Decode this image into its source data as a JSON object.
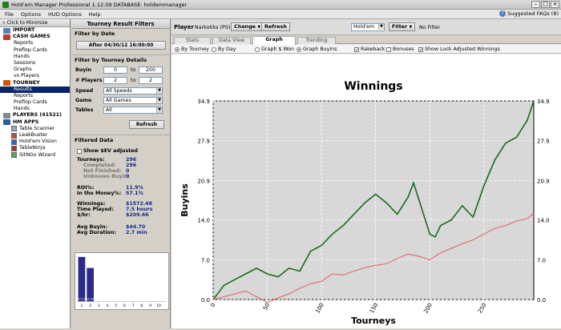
{
  "window": {
    "title": "Hold'em Manager Professional 1.12.09     DATABASE: holdemmanager"
  },
  "menu": {
    "items": [
      "File",
      "Options",
      "HUD Options",
      "Help"
    ],
    "faq": "Suggested FAQs (8)"
  },
  "nav": {
    "minimize_label": "Click to Minimize",
    "import": "IMPORT",
    "cash_games": "CASH GAMES",
    "cash_items": [
      "Reports",
      "Preflop Cards",
      "Hands",
      "Sessions",
      "Graphs",
      "vs Players"
    ],
    "tourney": "TOURNEY",
    "tourney_items": [
      "Results",
      "Reports",
      "Preflop Cards",
      "Hands"
    ],
    "players": "PLAYERS (41521)",
    "hm_apps": "HM APPS",
    "apps": [
      "Table Scanner",
      "LeakBuster",
      "Hold'em Vision",
      "TableNinja",
      "SitNGo Wizard"
    ]
  },
  "filters": {
    "title": "Tourney Result Filters",
    "by_date": "Filter by Date",
    "after_date": "After 04/30/12 16:00:00",
    "by_details": "Filter by Tourney Details",
    "buyin_label": "Buyin",
    "buyin_from": "0",
    "buyin_to": "200",
    "players_label": "# Players",
    "players_from": "2",
    "players_to": "2",
    "to": "to",
    "speed_label": "Speed",
    "speed_value": "All Speeds",
    "game_label": "Game",
    "game_value": "All Games",
    "tables_label": "Tables",
    "tables_value": "All",
    "refresh": "Refresh",
    "filtered_data": "Filtered Data",
    "sev_label": "Show $EV adjusted"
  },
  "stats": {
    "tourneys_label": "Tourneys:",
    "tourneys": "296",
    "completed_label": "Completed:",
    "completed": "296",
    "not_finished_label": "Not Finished:",
    "not_finished": "0",
    "unknown_buyin_label": "Unknown Buyin:",
    "unknown_buyin": "0",
    "roi_label": "ROI%:",
    "roi": "11.9%",
    "itm_label": "In the Money%:",
    "itm": "57.1%",
    "winnings_label": "Winnings:",
    "winnings": "$1572.48",
    "time_label": "Time Played:",
    "time": "7.5 hours",
    "hr_label": "$/hr:",
    "hr": "$209.66",
    "avg_buyin_label": "Avg Buyin:",
    "avg_buyin": "$44.70",
    "avg_duration_label": "Avg Duration:",
    "avg_duration": "2.7 min"
  },
  "minichart": {
    "bar_labels": [
      "57.1%",
      "42.9%"
    ],
    "x_ticks": [
      "1",
      "2",
      "3",
      "4",
      "5",
      "6",
      "7",
      "8",
      "9",
      "10"
    ],
    "values": [
      57.1,
      42.9
    ]
  },
  "toolbar": {
    "player_label": "Player",
    "player_name": "Narkotiks (PS)",
    "change": "Change",
    "refresh": "Refresh",
    "game": "Hold'em",
    "filter": "Filter",
    "no_filter": "No Filter"
  },
  "tabs": [
    "Stats",
    "Data View",
    "Graph",
    "Trending"
  ],
  "active_tab": "Graph",
  "options": {
    "by_tourney": "By Tourney",
    "by_day": "By Day",
    "graph_won": "Graph $ Won",
    "graph_buyins": "Graph Buyins",
    "rakeback": "Rakeback",
    "bonuses": "Bonuses",
    "luck": "Show Luck Adjusted Winnings"
  },
  "chart_data": {
    "type": "line",
    "title": "Winnings",
    "xlabel": "Tourneys",
    "ylabel": "Buyins",
    "xlim": [
      0,
      296
    ],
    "ylim": [
      0,
      34.9
    ],
    "y_ticks": [
      0.0,
      7.0,
      14.0,
      20.9,
      27.9,
      34.9
    ],
    "y_tick_labels": [
      "0.0",
      "7.0",
      "14.0",
      "20.9",
      "27.9",
      "34.9"
    ],
    "x_ticks": [
      0,
      50,
      100,
      150,
      200,
      250
    ],
    "grid": true,
    "series": [
      {
        "color": "#1a6b1a",
        "x": [
          0,
          10,
          20,
          30,
          40,
          50,
          60,
          70,
          80,
          90,
          100,
          110,
          120,
          130,
          140,
          150,
          160,
          170,
          180,
          185,
          190,
          200,
          205,
          210,
          220,
          230,
          240,
          250,
          260,
          270,
          280,
          290,
          296
        ],
        "values": [
          0,
          2.5,
          3.5,
          4.5,
          5.5,
          4.5,
          4.0,
          5.5,
          5.0,
          8.5,
          9.5,
          11.5,
          13.0,
          15.0,
          17.0,
          18.5,
          17.0,
          15.0,
          18.0,
          20.5,
          17.5,
          11.5,
          11.0,
          13.0,
          14.0,
          16.5,
          14.5,
          20.0,
          24.5,
          27.5,
          28.5,
          31.5,
          34.9
        ]
      },
      {
        "color": "#e06060",
        "x": [
          0,
          10,
          20,
          30,
          40,
          50,
          60,
          70,
          80,
          90,
          100,
          110,
          120,
          130,
          140,
          150,
          160,
          170,
          180,
          190,
          200,
          210,
          220,
          230,
          240,
          250,
          260,
          270,
          280,
          290,
          296
        ],
        "values": [
          0,
          0.5,
          1.0,
          1.5,
          0.5,
          -0.5,
          0.3,
          1.0,
          2.0,
          2.8,
          3.2,
          4.5,
          4.3,
          5.0,
          5.6,
          6.0,
          6.3,
          7.2,
          8.0,
          7.6,
          7.0,
          8.2,
          9.0,
          9.8,
          10.5,
          11.5,
          12.5,
          13.0,
          13.8,
          14.2,
          15.2
        ]
      }
    ]
  }
}
